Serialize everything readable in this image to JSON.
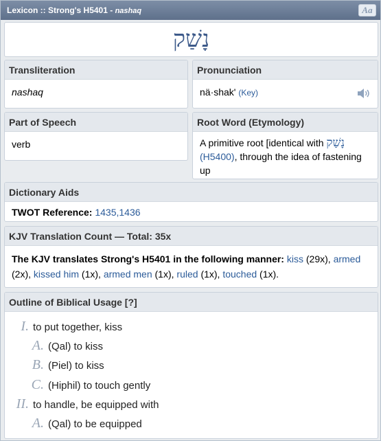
{
  "header": {
    "title": "Lexicon :: Strong's H5401 - ",
    "translit": "nashaq",
    "aa_button": "Aa"
  },
  "hebrew_word": "נָשַׁק",
  "transliteration": {
    "heading": "Transliteration",
    "value": "nashaq"
  },
  "pronunciation": {
    "heading": "Pronunciation",
    "value": "nä·shak'",
    "key_link": "(Key)"
  },
  "part_of_speech": {
    "heading": "Part of Speech",
    "value": "verb"
  },
  "root_word": {
    "heading": "Root Word (Etymology)",
    "prefix": "A primitive root [identical with ",
    "hebrew": "נָשַׁק",
    "ref_link": "(H5400)",
    "suffix": ", through the idea of fastening up"
  },
  "dictionary_aids": {
    "heading": "Dictionary Aids",
    "label": "TWOT Reference:",
    "value": "1435,1436"
  },
  "kjv": {
    "heading": "KJV Translation Count — Total: 35x",
    "intro": "The KJV translates Strong's H5401 in the following manner:",
    "items": [
      {
        "word": "kiss",
        "count": "(29x),"
      },
      {
        "word": "armed",
        "count": "(2x),"
      },
      {
        "word": "kissed him",
        "count": "(1x),"
      },
      {
        "word": "armed men",
        "count": "(1x),"
      },
      {
        "word": "ruled",
        "count": "(1x),"
      },
      {
        "word": "touched",
        "count": "(1x)."
      }
    ]
  },
  "outline": {
    "heading": "Outline of Biblical Usage [?]",
    "rows": [
      {
        "num": "I.",
        "text": "to put together, kiss"
      },
      {
        "num": "A.",
        "text": "(Qal) to kiss"
      },
      {
        "num": "B.",
        "text": "(Piel) to kiss"
      },
      {
        "num": "C.",
        "text": "(Hiphil) to touch gently"
      },
      {
        "num": "II.",
        "text": "to handle, be equipped with"
      },
      {
        "num": "A.",
        "text": "(Qal) to be equipped"
      }
    ]
  }
}
